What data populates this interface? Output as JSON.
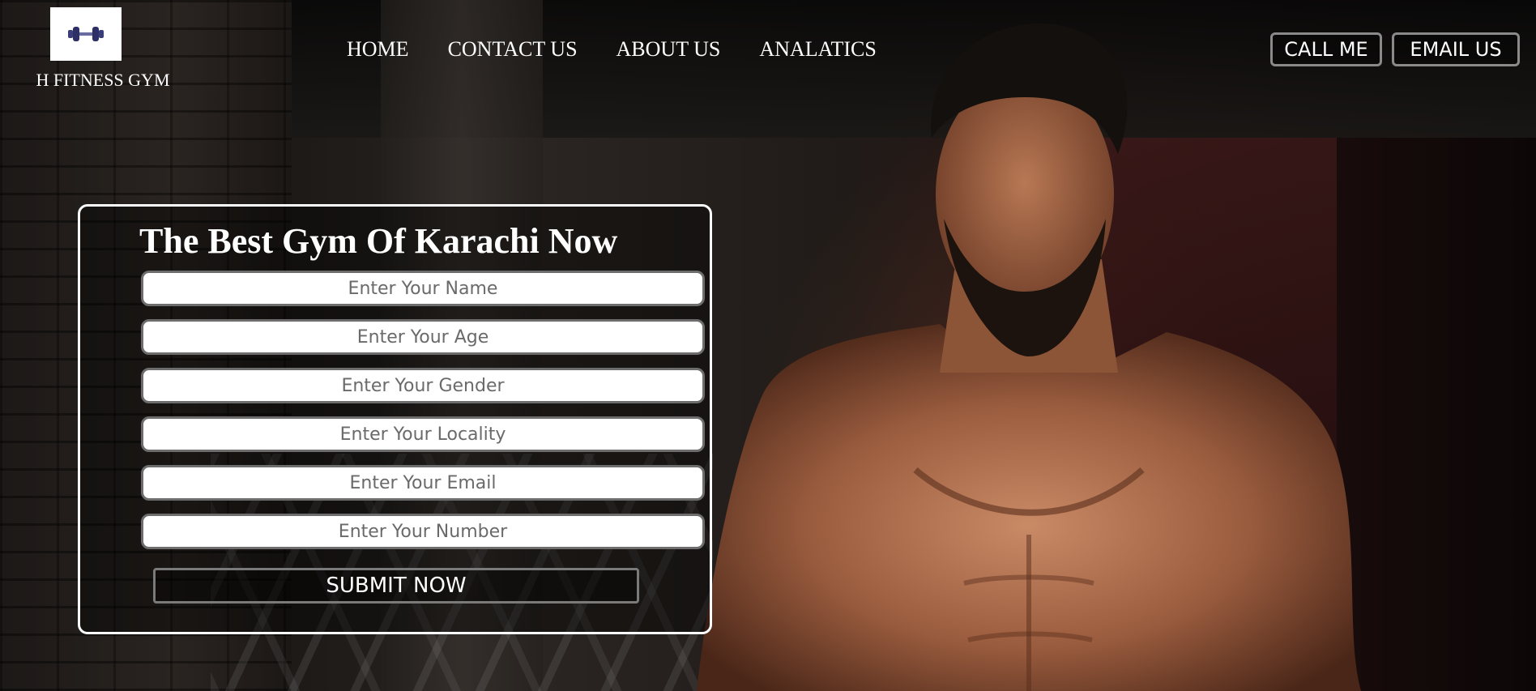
{
  "header": {
    "logo_icon": "dumbbell-icon",
    "brand": "H FITNESS GYM",
    "nav": [
      "HOME",
      "CONTACT US",
      "ABOUT US",
      "ANALATICS"
    ],
    "call_label": "CALL ME",
    "email_label": "EMAIL US"
  },
  "form": {
    "title": "The Best Gym Of Karachi Now",
    "fields": [
      {
        "placeholder": "Enter Your Name",
        "value": ""
      },
      {
        "placeholder": "Enter Your Age",
        "value": ""
      },
      {
        "placeholder": "Enter Your Gender",
        "value": ""
      },
      {
        "placeholder": "Enter Your Locality",
        "value": ""
      },
      {
        "placeholder": "Enter Your Email",
        "value": ""
      },
      {
        "placeholder": "Enter Your Number",
        "value": ""
      }
    ],
    "submit_label": "SUBMIT NOW"
  },
  "colors": {
    "text": "#ffffff",
    "field_border": "#6d6d6d",
    "button_border": "#8a8a8a"
  }
}
